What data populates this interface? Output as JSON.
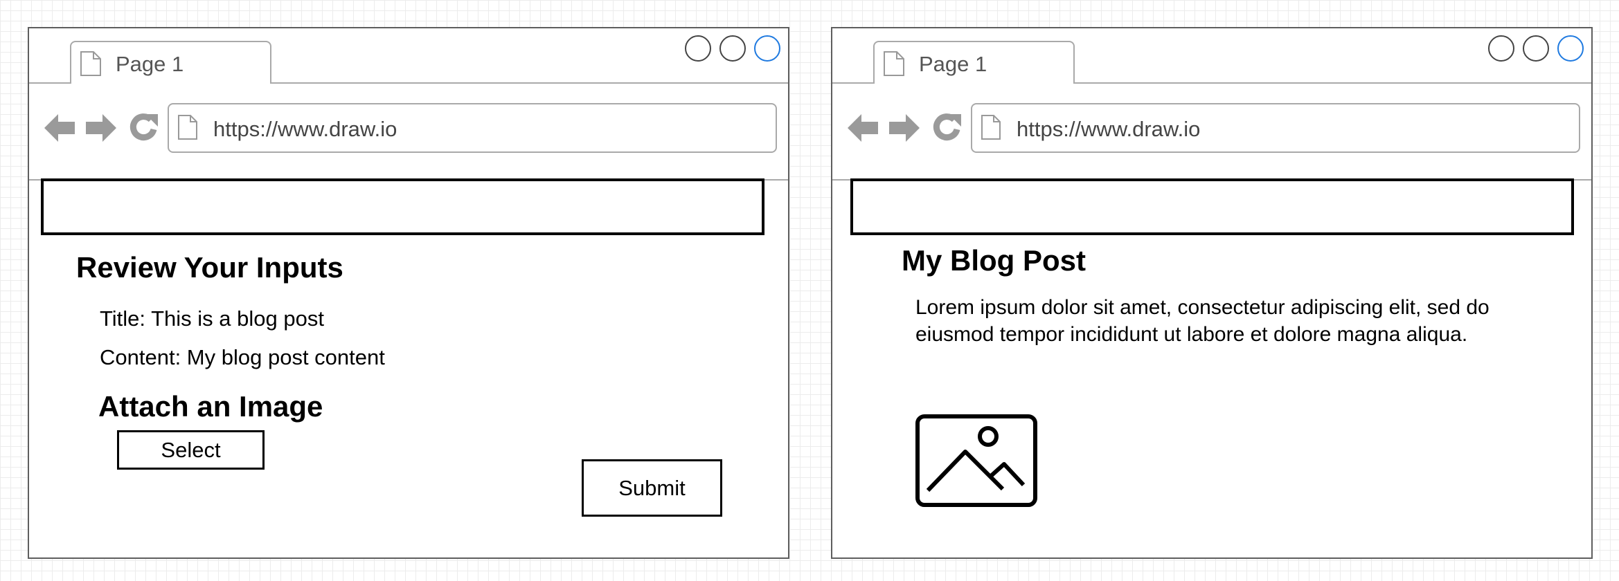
{
  "windows": [
    {
      "tab_label": "Page 1",
      "url": "https://www.draw.io",
      "heading": "Review Your Inputs",
      "title_line": "Title: This is a blog post",
      "content_line": "Content: My blog post content",
      "attach_heading": "Attach an Image",
      "select_label": "Select",
      "submit_label": "Submit"
    },
    {
      "tab_label": "Page 1",
      "url": "https://www.draw.io",
      "post_title": "My Blog Post",
      "post_body": "Lorem ipsum dolor sit amet, consectetur adipiscing elit, sed do eiusmod tempor incididunt ut labore et dolore magna aliqua.",
      "image_icon": "image-placeholder-icon"
    }
  ],
  "colors": {
    "chrome_gray": "#a9a9a9",
    "icon_gray": "#9a9a9a",
    "active_control": "#1f7ae0"
  }
}
